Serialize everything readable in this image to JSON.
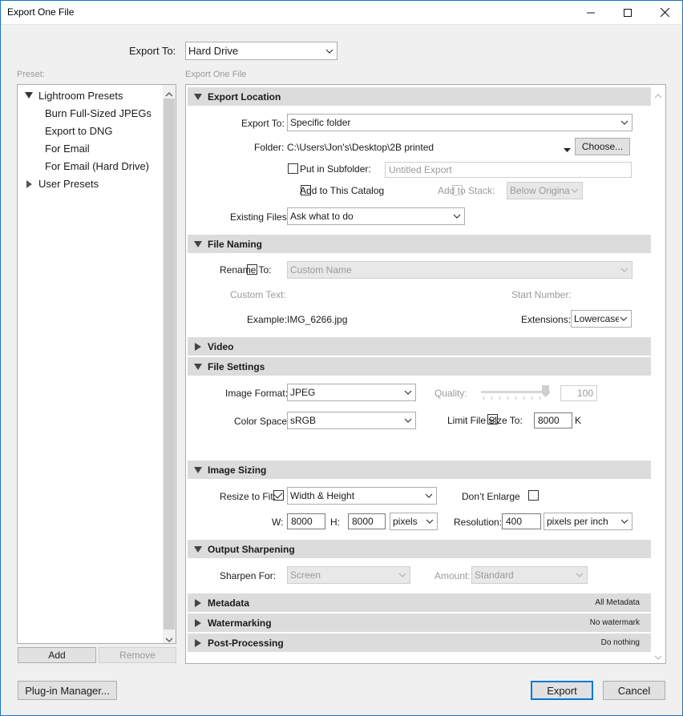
{
  "window": {
    "title": "Export One File"
  },
  "export_to_top": {
    "label": "Export To:",
    "value": "Hard Drive"
  },
  "preset_panel": {
    "label": "Preset:",
    "groups": [
      {
        "label": "Lightroom Presets",
        "expanded": true,
        "items": [
          "Burn Full-Sized JPEGs",
          "Export to DNG",
          "For Email",
          "For Email (Hard Drive)"
        ]
      },
      {
        "label": "User Presets",
        "expanded": false,
        "items": []
      }
    ],
    "add_label": "Add",
    "remove_label": "Remove"
  },
  "right_panel_label": "Export One File",
  "export_location": {
    "title": "Export Location",
    "export_to_label": "Export To:",
    "export_to_value": "Specific folder",
    "folder_label": "Folder:",
    "folder_path": "C:\\Users\\Jon's\\Desktop\\2B printed",
    "choose_label": "Choose...",
    "subfolder_label": "Put in Subfolder:",
    "subfolder_placeholder": "Untitled Export",
    "add_catalog_label": "Add to This Catalog",
    "add_stack_label": "Add to Stack:",
    "stack_value": "Below Original",
    "existing_files_label": "Existing Files:",
    "existing_files_value": "Ask what to do"
  },
  "file_naming": {
    "title": "File Naming",
    "rename_label": "Rename To:",
    "rename_value": "Custom Name",
    "custom_text_label": "Custom Text:",
    "start_number_label": "Start Number:",
    "example_label": "Example:",
    "example_value": "IMG_6266.jpg",
    "extensions_label": "Extensions:",
    "extensions_value": "Lowercase"
  },
  "video": {
    "title": "Video"
  },
  "file_settings": {
    "title": "File Settings",
    "image_format_label": "Image Format:",
    "image_format_value": "JPEG",
    "quality_label": "Quality:",
    "quality_value": "100",
    "quality_fraction": 1.0,
    "color_space_label": "Color Space:",
    "color_space_value": "sRGB",
    "limit_size_label": "Limit File Size To:",
    "limit_size_value": "8000",
    "limit_size_unit": "K"
  },
  "image_sizing": {
    "title": "Image Sizing",
    "resize_label": "Resize to Fit:",
    "resize_value": "Width & Height",
    "dont_enlarge_label": "Don’t Enlarge",
    "w_label": "W:",
    "w_value": "8000",
    "h_label": "H:",
    "h_value": "8000",
    "unit_value": "pixels",
    "resolution_label": "Resolution:",
    "resolution_value": "400",
    "resolution_unit": "pixels per inch"
  },
  "output_sharpening": {
    "title": "Output Sharpening",
    "sharpen_label": "Sharpen For:",
    "sharpen_value": "Screen",
    "amount_label": "Amount:",
    "amount_value": "Standard"
  },
  "metadata": {
    "title": "Metadata",
    "summary": "All Metadata"
  },
  "watermarking": {
    "title": "Watermarking",
    "summary": "No watermark"
  },
  "post_processing": {
    "title": "Post-Processing",
    "summary": "Do nothing"
  },
  "footer": {
    "plugin_manager_label": "Plug-in Manager...",
    "export_label": "Export",
    "cancel_label": "Cancel"
  },
  "colors": {
    "accent": "#0078d7",
    "section_bg": "#dcdcdc",
    "window_border": "#1a73c6"
  }
}
